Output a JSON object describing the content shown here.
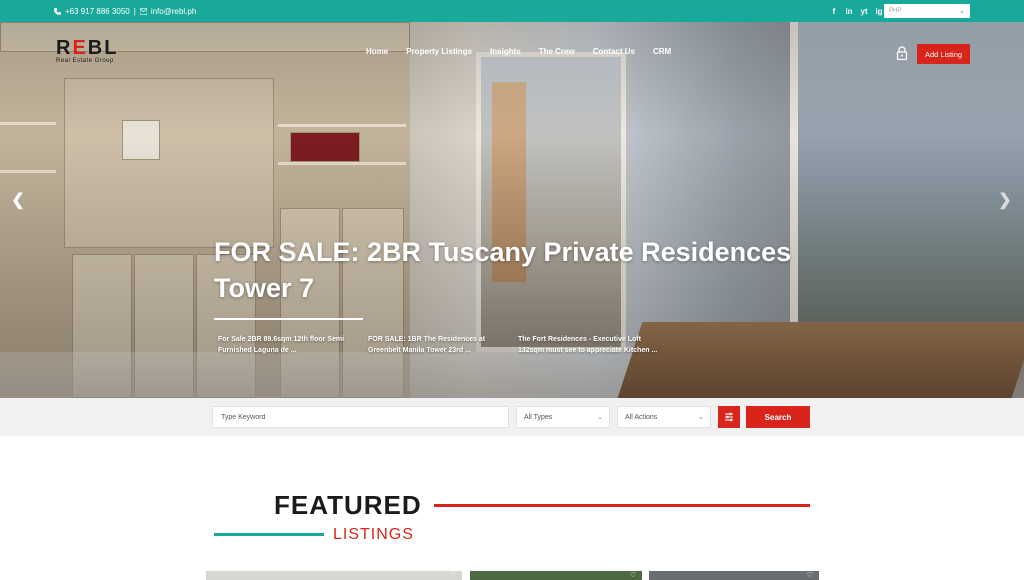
{
  "topbar": {
    "phone": "+63 917 886 3050",
    "separator": "|",
    "email": "info@rebl.ph",
    "social": [
      "f",
      "in",
      "yt",
      "ig"
    ],
    "currency": "PHP"
  },
  "brand": {
    "logo_r": "R",
    "logo_e": "E",
    "logo_bl": "BL",
    "tagline": "Real Estate Group",
    "accent": "#d9241c",
    "teal": "#18a99b"
  },
  "nav": {
    "items": [
      "Home",
      "Property Listings",
      "Insights",
      "The Crew",
      "Contact Us",
      "CRM"
    ],
    "add_listing": "Add Listing"
  },
  "hero": {
    "title": "FOR SALE: 2BR Tuscany Private Residences Tower 7",
    "slides": [
      "For Sale 2BR 89.6sqm 12th floor Semi Furnished Laguna de ...",
      "FOR SALE: 1BR The Residences at Greenbelt Manila Tower 23rd ...",
      "The Fort Residences - Executive Loft 132sqm must see to appreciate Kitchen ..."
    ]
  },
  "search": {
    "keyword_placeholder": "Type Keyword",
    "types": "All Types",
    "actions": "All Actions",
    "button": "Search"
  },
  "featured": {
    "title": "FEATURED",
    "subtitle": "LISTINGS"
  }
}
